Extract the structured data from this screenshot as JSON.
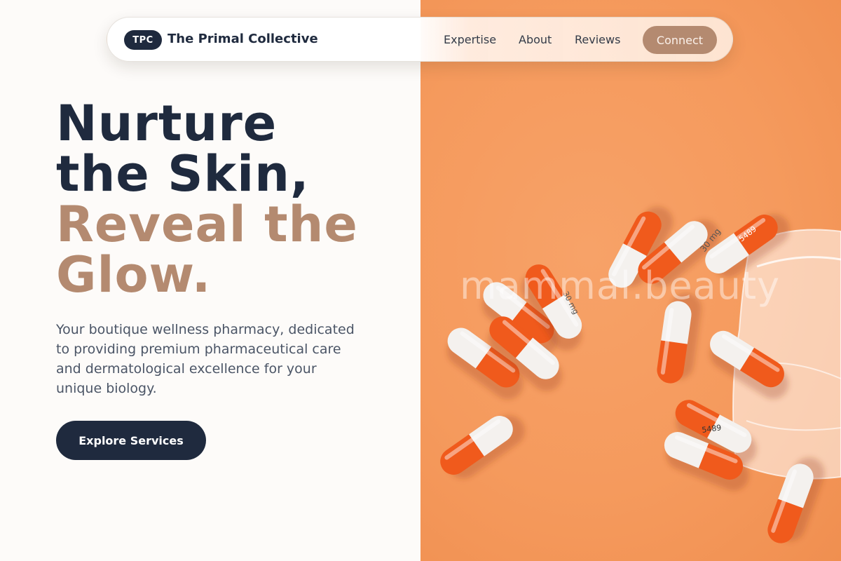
{
  "nav": {
    "logo_badge": "TPC",
    "brand": "The Primal Collective",
    "links": [
      "Expertise",
      "About",
      "Reviews"
    ],
    "cta": "Connect"
  },
  "hero": {
    "title_lines_dark": [
      "Nurture",
      "the Skin,"
    ],
    "title_lines_accent": [
      "Reveal the",
      "Glow."
    ],
    "description": "Your boutique wellness pharmacy, dedicated to providing premium pharmaceutical care and dermatological excellence for your unique biology.",
    "cta": "Explore Services"
  },
  "image": {
    "watermark": "mammal.beauty",
    "subject": "orange-and-white capsules spilling from a clear bag",
    "capsule_prints": [
      "30 mg",
      "5489",
      "30 mg",
      "5489",
      "30 mg",
      "5489"
    ]
  },
  "colors": {
    "navy": "#1f2a3e",
    "accent_tan": "#b48a70",
    "background": "#fdfbf9",
    "photo_orange": "#f59a5d",
    "capsule_orange": "#f05a1c"
  }
}
